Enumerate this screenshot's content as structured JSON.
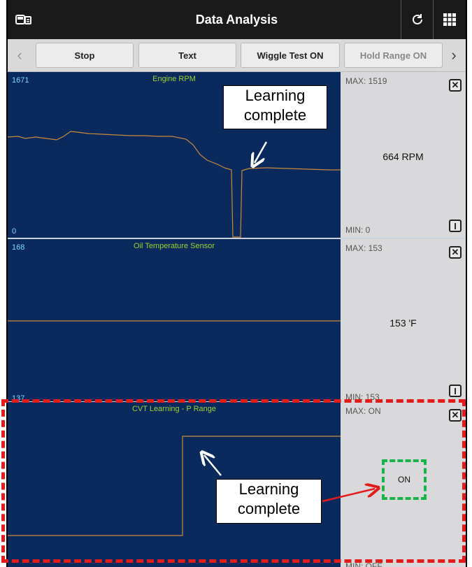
{
  "header": {
    "title": "Data Analysis"
  },
  "toolbar": {
    "buttons": [
      {
        "label": "Stop"
      },
      {
        "label": "Text"
      },
      {
        "label": "Wiggle Test ON"
      },
      {
        "label": "Hold Range ON"
      }
    ]
  },
  "graphs": [
    {
      "title": "Engine RPM",
      "scale_max": "1671",
      "scale_min": "0",
      "max_label": "MAX: 1519",
      "min_label": "MIN: 0",
      "value": "664 RPM"
    },
    {
      "title": "Oil Temperature Sensor",
      "scale_max": "168",
      "scale_min": "137",
      "max_label": "MAX: 153",
      "min_label": "MIN: 153",
      "value": "153 'F"
    },
    {
      "title": "CVT Learning - P Range",
      "max_label": "MAX: ON",
      "min_label": "MIN: OFF",
      "value": "ON"
    }
  ],
  "annotations": {
    "callout_1": [
      "Learning",
      "complete"
    ],
    "callout_2": [
      "Learning",
      "complete"
    ]
  },
  "colors": {
    "plot_bg": "#0a2a5e",
    "trace": "#c98a3a",
    "title_green": "#9bd330",
    "highlight_red": "#e41b1b",
    "highlight_green": "#19b34a"
  }
}
